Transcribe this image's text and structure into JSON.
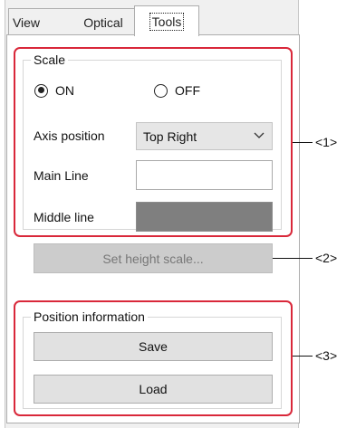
{
  "tabs": [
    {
      "label": "View"
    },
    {
      "label": "Optical"
    },
    {
      "label": "Tools"
    }
  ],
  "active_tab": "Tools",
  "scale": {
    "title": "Scale",
    "on_label": "ON",
    "off_label": "OFF",
    "selected": "ON",
    "axis_position_label": "Axis position",
    "axis_position_value": "Top Right",
    "main_line_label": "Main Line",
    "main_line_color": "#ffffff",
    "middle_line_label": "Middle line",
    "middle_line_color": "#7f7f7f"
  },
  "set_height_button": "Set height scale...",
  "position_info": {
    "title": "Position information",
    "save_label": "Save",
    "load_label": "Load"
  },
  "callouts": [
    "<1>",
    "<2>",
    "<3>"
  ],
  "colors": {
    "highlight_box": "#d9283a"
  }
}
